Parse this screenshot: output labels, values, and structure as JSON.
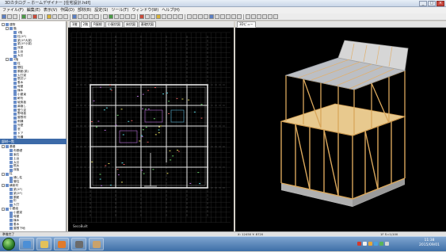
{
  "window": {
    "title": "3Dカタログ ─ ホームデザイナー [住宅設計.hdf]",
    "controls": [
      "minimize",
      "maximize",
      "close"
    ]
  },
  "menu": [
    "ファイル(F)",
    "編集(E)",
    "表示(V)",
    "作図(D)",
    "部材(B)",
    "設定(S)",
    "ツール(T)",
    "ウィンドウ(W)",
    "ヘルプ(H)"
  ],
  "panes": {
    "plan": {
      "tabs": [
        "1階",
        "2階",
        "R屋根",
        "小屋伏図",
        "床伏図",
        "基礎伏図"
      ],
      "active_tab": 1,
      "bottom_label": "SecoBuilt"
    },
    "view3d": {
      "label": "3Dビュー"
    }
  },
  "tree_top": [
    {
      "label": "建物",
      "level": 0,
      "expand": "-"
    },
    {
      "label": "階",
      "level": 1,
      "expand": "-"
    },
    {
      "label": "1階",
      "level": 2,
      "expand": ""
    },
    {
      "label": "柱(1F)",
      "level": 2,
      "expand": ""
    },
    {
      "label": "梁(1F大梁)",
      "level": 2,
      "expand": ""
    },
    {
      "label": "梁(1F小梁)",
      "level": 2,
      "expand": ""
    },
    {
      "label": "床梁",
      "level": 2,
      "expand": ""
    },
    {
      "label": "土台",
      "level": 2,
      "expand": ""
    },
    {
      "label": "大引",
      "level": 2,
      "expand": ""
    },
    {
      "label": "2階",
      "level": 1,
      "expand": "-"
    },
    {
      "label": "柱",
      "level": 2,
      "expand": ""
    },
    {
      "label": "間柱",
      "level": 2,
      "expand": ""
    },
    {
      "label": "胴差(梁)",
      "level": 2,
      "expand": ""
    },
    {
      "label": "火打梁",
      "level": 2,
      "expand": ""
    },
    {
      "label": "筋交い",
      "level": 2,
      "expand": ""
    },
    {
      "label": "垂木",
      "level": 2,
      "expand": ""
    },
    {
      "label": "母屋",
      "level": 2,
      "expand": ""
    },
    {
      "label": "棟木",
      "level": 2,
      "expand": ""
    },
    {
      "label": "小屋束",
      "level": 2,
      "expand": ""
    },
    {
      "label": "軒桁",
      "level": 2,
      "expand": ""
    },
    {
      "label": "破風板",
      "level": 2,
      "expand": ""
    },
    {
      "label": "鼻隠し",
      "level": 2,
      "expand": ""
    },
    {
      "label": "登り淀",
      "level": 2,
      "expand": ""
    },
    {
      "label": "野地板",
      "level": 2,
      "expand": ""
    },
    {
      "label": "屋根材",
      "level": 2,
      "expand": ""
    },
    {
      "label": "雨樋",
      "level": 2,
      "expand": ""
    },
    {
      "label": "外壁",
      "level": 2,
      "expand": ""
    },
    {
      "label": "窓",
      "level": 2,
      "expand": ""
    },
    {
      "label": "ドア",
      "level": 2,
      "expand": ""
    },
    {
      "label": "外構",
      "level": 2,
      "expand": ""
    }
  ],
  "panel2_header": "部材一覧",
  "tree_bottom": [
    {
      "label": "基礎",
      "level": 0,
      "expand": "-"
    },
    {
      "label": "布基礎",
      "level": 1,
      "expand": ""
    },
    {
      "label": "束石",
      "level": 1,
      "expand": ""
    },
    {
      "label": "土台",
      "level": 1,
      "expand": ""
    },
    {
      "label": "大引",
      "level": 1,
      "expand": ""
    },
    {
      "label": "根太",
      "level": 1,
      "expand": ""
    },
    {
      "label": "床板",
      "level": 1,
      "expand": ""
    },
    {
      "label": "柱",
      "level": 0,
      "expand": "-"
    },
    {
      "label": "通し柱",
      "level": 1,
      "expand": ""
    },
    {
      "label": "管柱",
      "level": 1,
      "expand": ""
    },
    {
      "label": "横架材",
      "level": 0,
      "expand": "-"
    },
    {
      "label": "梁(1F)",
      "level": 1,
      "expand": ""
    },
    {
      "label": "梁(2F)",
      "level": 1,
      "expand": ""
    },
    {
      "label": "胴差",
      "level": 1,
      "expand": ""
    },
    {
      "label": "桁",
      "level": 1,
      "expand": ""
    },
    {
      "label": "火打",
      "level": 1,
      "expand": ""
    },
    {
      "label": "小屋組",
      "level": 0,
      "expand": "-"
    },
    {
      "label": "小屋梁",
      "level": 1,
      "expand": ""
    },
    {
      "label": "母屋",
      "level": 1,
      "expand": ""
    },
    {
      "label": "棟木",
      "level": 1,
      "expand": ""
    },
    {
      "label": "垂木",
      "level": 1,
      "expand": ""
    },
    {
      "label": "屋根下地",
      "level": 1,
      "expand": ""
    }
  ],
  "status": {
    "left": "準備完了",
    "mid": "X: 12450  Y: 8720",
    "right": "1F  S=1/100"
  },
  "taskbar": {
    "apps": [
      "explorer",
      "folder",
      "media",
      "app1",
      "app2",
      "app3"
    ],
    "time": "11:38",
    "date": "2015/09/01"
  },
  "colors": {
    "plan_bg": "#000000",
    "grid": "#5a5a5a",
    "wall": "#e6e6e6",
    "wood": "#d9a75c",
    "accent": "#3c6aa8"
  }
}
